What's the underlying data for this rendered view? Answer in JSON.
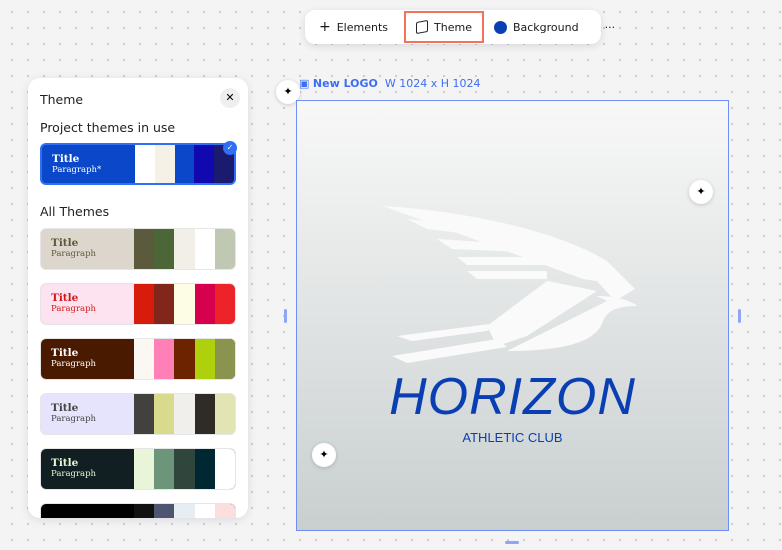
{
  "toolbar": {
    "elements": "Elements",
    "theme": "Theme",
    "background": "Background",
    "more": "···",
    "background_color": "#0a3fb3"
  },
  "panel": {
    "title": "Theme",
    "close": "✕",
    "in_use": "Project themes in use",
    "all": "All Themes"
  },
  "current_theme": {
    "title": "Title",
    "paragraph": "Paragraph*",
    "bg": "#0a47c9",
    "fg": "#ffffff",
    "swatches": [
      "#ffffff",
      "#f5f1e6",
      "#0a47c9",
      "#1208b0",
      "#1a1a6e"
    ]
  },
  "themes": [
    {
      "title": "Title",
      "paragraph": "Paragraph",
      "bg": "#ddd6cc",
      "fg": "#5a5a3a",
      "swatches": [
        "#5c5a3c",
        "#4d6637",
        "#f1efe7",
        "#ffffff",
        "#c0c8b3"
      ]
    },
    {
      "title": "Title",
      "paragraph": "Paragraph",
      "bg": "#fde3ef",
      "fg": "#d41818",
      "swatches": [
        "#d81c0c",
        "#80261b",
        "#fdfde6",
        "#d6004e",
        "#ec2328"
      ]
    },
    {
      "title": "Title",
      "paragraph": "Paragraph",
      "bg": "#4a1a00",
      "fg": "#ffffff",
      "swatches": [
        "#fbf8f3",
        "#fe80b7",
        "#6d2200",
        "#afd00c",
        "#8a944f"
      ]
    },
    {
      "title": "Title",
      "paragraph": "Paragraph",
      "bg": "#e6e4fd",
      "fg": "#444444",
      "swatches": [
        "#434140",
        "#d8da8e",
        "#f0efec",
        "#2f2b26",
        "#e3e4b3"
      ]
    },
    {
      "title": "Title",
      "paragraph": "Paragraph",
      "bg": "#111e22",
      "fg": "#e8f5d8",
      "swatches": [
        "#e8f5d8",
        "#6d957a",
        "#30453c",
        "#002833",
        "#ffffff"
      ]
    },
    {
      "title": "",
      "paragraph": "",
      "bg": "#000000",
      "fg": "#333333",
      "swatches": [
        "#111111",
        "#4d5670",
        "#e6edf3",
        "#ffffff",
        "#fddede"
      ]
    }
  ],
  "canvas": {
    "name": "New LOGO",
    "size": "W 1024 x H 1024",
    "brand": "HORIZON",
    "tagline": "ATHLETIC CLUB",
    "ai_icon": "✦"
  }
}
